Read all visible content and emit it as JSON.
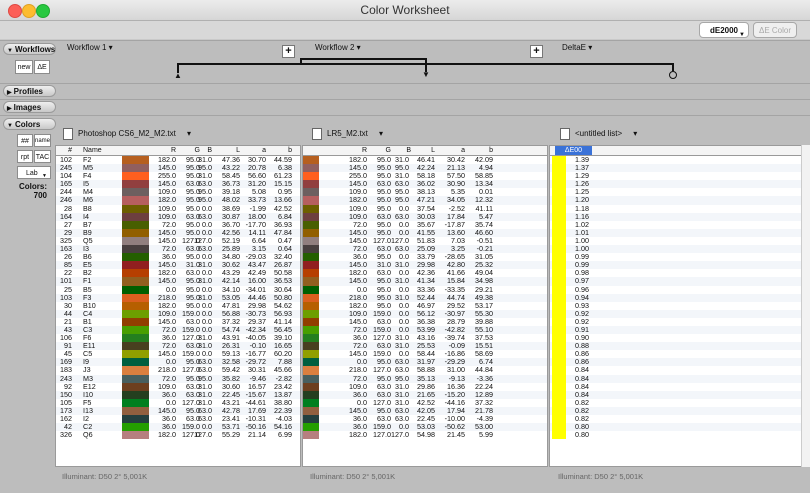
{
  "window": {
    "title": "Color Worksheet"
  },
  "toolbar": {
    "de_button": "dE2000",
    "de_color_button": "ΔE Color"
  },
  "sections": {
    "workflows": "Workflows",
    "profiles": "Profiles",
    "images": "Images",
    "colors": "Colors"
  },
  "workflow_side": {
    "new": "new",
    "de": "ΔE"
  },
  "workflows": [
    "Workflow 1",
    "Workflow 2",
    "DeltaE"
  ],
  "colors_side": {
    "hash": "##",
    "name": "name",
    "rpt": "rpt",
    "tac": "TAC",
    "lab": "Lab",
    "count_label": "Colors:",
    "count": "700"
  },
  "files": [
    "Photoshop CS6_M2_M2.txt",
    "LR5_M2.txt",
    "<untitled list>"
  ],
  "columns": {
    "idx": "#",
    "name": "Name",
    "r": "R",
    "g": "G",
    "b": "B",
    "l": "L",
    "a": "a",
    "b2": "b",
    "de": "ΔE00"
  },
  "status": {
    "left": "Illuminant: D50 2° 5,001K",
    "mid": "Illuminant: D50 2° 5,001K",
    "right": "Illuminant: D50 2° 5,001K"
  },
  "table_rows": [
    [
      "102",
      "F2",
      "182.0",
      "95.0",
      "31.0",
      "47.36",
      "30.70",
      "44.59",
      "182.0",
      "95.0",
      "31.0",
      "46.41",
      "30.42",
      "42.09",
      "1.39",
      "#b65f1f"
    ],
    [
      "245",
      "M5",
      "145.0",
      "95.0",
      "95.0",
      "43.22",
      "20.78",
      "6.38",
      "145.0",
      "95.0",
      "95.0",
      "42.24",
      "21.13",
      "4.94",
      "1.37",
      "#915f5f"
    ],
    [
      "104",
      "F4",
      "255.0",
      "95.0",
      "31.0",
      "58.45",
      "56.60",
      "61.23",
      "255.0",
      "95.0",
      "31.0",
      "58.18",
      "57.50",
      "58.85",
      "1.29",
      "#ff5f1f"
    ],
    [
      "165",
      "I5",
      "145.0",
      "63.0",
      "63.0",
      "36.73",
      "31.20",
      "15.15",
      "145.0",
      "63.0",
      "63.0",
      "36.02",
      "30.90",
      "13.34",
      "1.26",
      "#913f3f"
    ],
    [
      "244",
      "M4",
      "109.0",
      "95.0",
      "95.0",
      "39.18",
      "5.08",
      "0.95",
      "109.0",
      "95.0",
      "95.0",
      "38.13",
      "5.35",
      "0.01",
      "1.25",
      "#6d5f5f"
    ],
    [
      "246",
      "M6",
      "182.0",
      "95.0",
      "95.0",
      "48.02",
      "33.73",
      "13.66",
      "182.0",
      "95.0",
      "95.0",
      "47.21",
      "34.05",
      "12.32",
      "1.20",
      "#b65f5f"
    ],
    [
      "28",
      "B8",
      "109.0",
      "95.0",
      "0.0",
      "38.69",
      "-1.99",
      "42.52",
      "109.0",
      "95.0",
      "0.0",
      "37.54",
      "-2.52",
      "41.11",
      "1.18",
      "#6d5f00"
    ],
    [
      "164",
      "I4",
      "109.0",
      "63.0",
      "63.0",
      "30.87",
      "18.00",
      "6.84",
      "109.0",
      "63.0",
      "63.0",
      "30.03",
      "17.84",
      "5.47",
      "1.16",
      "#6d3f3f"
    ],
    [
      "27",
      "B7",
      "72.0",
      "95.0",
      "0.0",
      "36.70",
      "-17.70",
      "36.93",
      "72.0",
      "95.0",
      "0.0",
      "35.67",
      "-17.87",
      "35.74",
      "1.02",
      "#485f00"
    ],
    [
      "29",
      "B9",
      "145.0",
      "95.0",
      "0.0",
      "42.56",
      "14.11",
      "47.84",
      "145.0",
      "95.0",
      "0.0",
      "41.55",
      "13.60",
      "46.60",
      "1.01",
      "#915f00"
    ],
    [
      "325",
      "Q5",
      "145.0",
      "127.0",
      "127.0",
      "52.19",
      "6.64",
      "0.47",
      "145.0",
      "127.0",
      "127.0",
      "51.83",
      "7.03",
      "-0.51",
      "1.00",
      "#917f7f"
    ],
    [
      "163",
      "I3",
      "72.0",
      "63.0",
      "63.0",
      "25.89",
      "3.15",
      "0.64",
      "72.0",
      "63.0",
      "63.0",
      "25.09",
      "3.25",
      "-0.21",
      "1.00",
      "#483f3f"
    ],
    [
      "26",
      "B6",
      "36.0",
      "95.0",
      "0.0",
      "34.80",
      "-29.03",
      "32.40",
      "36.0",
      "95.0",
      "0.0",
      "33.79",
      "-28.65",
      "31.05",
      "0.99",
      "#245f00"
    ],
    [
      "85",
      "E5",
      "145.0",
      "31.0",
      "31.0",
      "30.62",
      "43.47",
      "26.87",
      "145.0",
      "31.0",
      "31.0",
      "29.98",
      "42.80",
      "25.32",
      "0.99",
      "#911f1f"
    ],
    [
      "22",
      "B2",
      "182.0",
      "63.0",
      "0.0",
      "43.29",
      "42.49",
      "50.58",
      "182.0",
      "63.0",
      "0.0",
      "42.36",
      "41.66",
      "49.04",
      "0.98",
      "#b63f00"
    ],
    [
      "101",
      "F1",
      "145.0",
      "95.0",
      "31.0",
      "42.14",
      "16.00",
      "36.53",
      "145.0",
      "95.0",
      "31.0",
      "41.34",
      "15.84",
      "34.98",
      "0.97",
      "#915f1f"
    ],
    [
      "25",
      "B5",
      "0.0",
      "95.0",
      "0.0",
      "34.10",
      "-34.01",
      "30.64",
      "0.0",
      "95.0",
      "0.0",
      "33.36",
      "-33.35",
      "29.21",
      "0.96",
      "#005f00"
    ],
    [
      "103",
      "F3",
      "218.0",
      "95.0",
      "31.0",
      "53.05",
      "44.46",
      "50.80",
      "218.0",
      "95.0",
      "31.0",
      "52.44",
      "44.74",
      "49.38",
      "0.94",
      "#da5f1f"
    ],
    [
      "30",
      "B10",
      "182.0",
      "95.0",
      "0.0",
      "47.81",
      "29.98",
      "54.62",
      "182.0",
      "95.0",
      "0.0",
      "46.97",
      "29.52",
      "53.17",
      "0.93",
      "#b65f00"
    ],
    [
      "44",
      "C4",
      "109.0",
      "159.0",
      "0.0",
      "56.88",
      "-30.73",
      "56.93",
      "109.0",
      "159.0",
      "0.0",
      "56.12",
      "-30.97",
      "55.30",
      "0.92",
      "#6d9f00"
    ],
    [
      "21",
      "B1",
      "145.0",
      "63.0",
      "0.0",
      "37.32",
      "29.37",
      "41.14",
      "145.0",
      "63.0",
      "0.0",
      "36.38",
      "28.79",
      "39.88",
      "0.92",
      "#913f00"
    ],
    [
      "43",
      "C3",
      "72.0",
      "159.0",
      "0.0",
      "54.74",
      "-42.34",
      "56.45",
      "72.0",
      "159.0",
      "0.0",
      "53.99",
      "-42.82",
      "55.10",
      "0.91",
      "#489f00"
    ],
    [
      "106",
      "F6",
      "36.0",
      "127.0",
      "31.0",
      "43.91",
      "-40.05",
      "39.10",
      "36.0",
      "127.0",
      "31.0",
      "43.16",
      "-39.74",
      "37.53",
      "0.90",
      "#247f1f"
    ],
    [
      "91",
      "E11",
      "72.0",
      "63.0",
      "31.0",
      "26.31",
      "-0.10",
      "16.65",
      "72.0",
      "63.0",
      "31.0",
      "25.53",
      "-0.09",
      "15.51",
      "0.88",
      "#483f1f"
    ],
    [
      "45",
      "C5",
      "145.0",
      "159.0",
      "0.0",
      "59.13",
      "-16.77",
      "60.20",
      "145.0",
      "159.0",
      "0.0",
      "58.44",
      "-16.86",
      "58.69",
      "0.86",
      "#919f00"
    ],
    [
      "169",
      "I9",
      "0.0",
      "95.0",
      "63.0",
      "32.58",
      "-29.72",
      "7.88",
      "0.0",
      "95.0",
      "63.0",
      "31.97",
      "-29.29",
      "6.74",
      "0.86",
      "#005f3f"
    ],
    [
      "183",
      "J3",
      "218.0",
      "127.0",
      "63.0",
      "59.42",
      "30.31",
      "45.66",
      "218.0",
      "127.0",
      "63.0",
      "58.88",
      "31.00",
      "44.84",
      "0.84",
      "#da7f3f"
    ],
    [
      "243",
      "M3",
      "72.0",
      "95.0",
      "95.0",
      "35.82",
      "-9.46",
      "-2.82",
      "72.0",
      "95.0",
      "95.0",
      "35.13",
      "-9.13",
      "-3.36",
      "0.84",
      "#485f5f"
    ],
    [
      "92",
      "E12",
      "109.0",
      "63.0",
      "31.0",
      "30.60",
      "16.57",
      "23.42",
      "109.0",
      "63.0",
      "31.0",
      "29.86",
      "16.36",
      "22.24",
      "0.84",
      "#6d3f1f"
    ],
    [
      "150",
      "I10",
      "36.0",
      "63.0",
      "31.0",
      "22.45",
      "-15.67",
      "13.87",
      "36.0",
      "63.0",
      "31.0",
      "21.65",
      "-15.20",
      "12.89",
      "0.84",
      "#243f1f"
    ],
    [
      "105",
      "F5",
      "0.0",
      "127.0",
      "31.0",
      "43.21",
      "-44.61",
      "38.80",
      "0.0",
      "127.0",
      "31.0",
      "42.52",
      "-44.16",
      "37.32",
      "0.82",
      "#007f1f"
    ],
    [
      "173",
      "I13",
      "145.0",
      "95.0",
      "63.0",
      "42.78",
      "17.69",
      "22.39",
      "145.0",
      "95.0",
      "63.0",
      "42.05",
      "17.94",
      "21.78",
      "0.82",
      "#915f3f"
    ],
    [
      "162",
      "I2",
      "36.0",
      "63.0",
      "63.0",
      "23.41",
      "-10.31",
      "-4.03",
      "36.0",
      "63.0",
      "63.0",
      "22.45",
      "-10.00",
      "-4.39",
      "0.82",
      "#243f3f"
    ],
    [
      "42",
      "C2",
      "36.0",
      "159.0",
      "0.0",
      "53.71",
      "-50.16",
      "54.16",
      "36.0",
      "159.0",
      "0.0",
      "53.03",
      "-50.62",
      "53.00",
      "0.80",
      "#249f00"
    ],
    [
      "326",
      "Q6",
      "182.0",
      "127.0",
      "127.0",
      "55.29",
      "21.14",
      "6.99",
      "182.0",
      "127.0",
      "127.0",
      "54.98",
      "21.45",
      "5.99",
      "0.80",
      "#b67f7f"
    ]
  ]
}
